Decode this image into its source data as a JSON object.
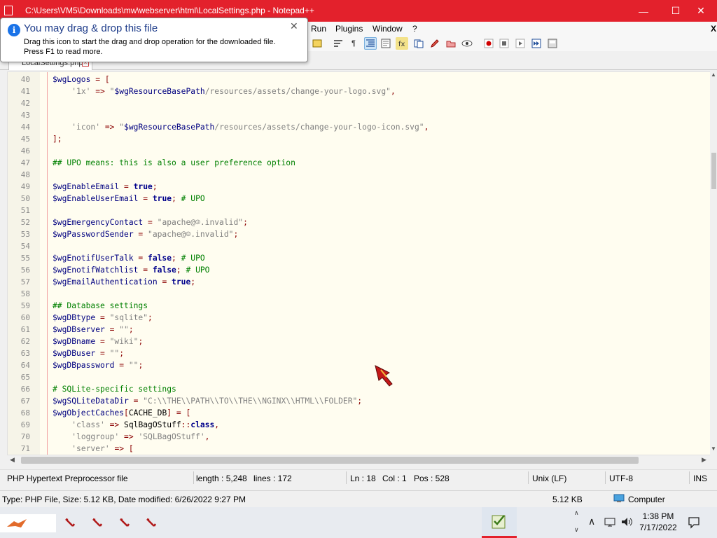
{
  "window": {
    "title": "C:\\Users\\VM5\\Downloads\\mw\\webserver\\html\\LocalSettings.php - Notepad++",
    "minimize_glyph": "—",
    "maximize_glyph": "☐",
    "close_glyph": "✕",
    "title_bar_color": "#e3212c"
  },
  "menu": {
    "items": [
      "Run",
      "Plugins",
      "Window",
      "?"
    ],
    "close_glyph": "X"
  },
  "tab": {
    "label": "LocalSettings.php"
  },
  "toast": {
    "title": "You may drag & drop this file",
    "body_line1": "Drag this icon to start the drag and drop operation for the downloaded file.",
    "body_line2": "Press F1 to read more.",
    "close_glyph": "✕",
    "icon": "info-icon"
  },
  "editor": {
    "lines": [
      {
        "n": "40",
        "tokens": [
          [
            "var",
            "$wgLogos"
          ],
          [
            "op",
            " = "
          ],
          [
            "op",
            "["
          ]
        ]
      },
      {
        "n": "41",
        "tokens": [
          [
            "plain",
            "    "
          ],
          [
            "str",
            "'1x'"
          ],
          [
            "op",
            " => "
          ],
          [
            "str",
            "\""
          ],
          [
            "var",
            "$wgResourceBasePath"
          ],
          [
            "str",
            "/resources/assets/change-your-logo.svg\""
          ],
          [
            "op",
            ","
          ]
        ]
      },
      {
        "n": "42",
        "tokens": []
      },
      {
        "n": "43",
        "tokens": []
      },
      {
        "n": "44",
        "tokens": [
          [
            "plain",
            "    "
          ],
          [
            "str",
            "'icon'"
          ],
          [
            "op",
            " => "
          ],
          [
            "str",
            "\""
          ],
          [
            "var",
            "$wgResourceBasePath"
          ],
          [
            "str",
            "/resources/assets/change-your-logo-icon.svg\""
          ],
          [
            "op",
            ","
          ]
        ]
      },
      {
        "n": "45",
        "tokens": [
          [
            "op",
            "];"
          ]
        ]
      },
      {
        "n": "46",
        "tokens": []
      },
      {
        "n": "47",
        "tokens": [
          [
            "cmt",
            "## UPO means: this is also a user preference option"
          ]
        ]
      },
      {
        "n": "48",
        "tokens": []
      },
      {
        "n": "49",
        "tokens": [
          [
            "var",
            "$wgEnableEmail"
          ],
          [
            "op",
            " = "
          ],
          [
            "kw",
            "true"
          ],
          [
            "op",
            ";"
          ]
        ]
      },
      {
        "n": "50",
        "tokens": [
          [
            "var",
            "$wgEnableUserEmail"
          ],
          [
            "op",
            " = "
          ],
          [
            "kw",
            "true"
          ],
          [
            "op",
            ";"
          ],
          [
            "cmt",
            " # UPO"
          ]
        ]
      },
      {
        "n": "51",
        "tokens": []
      },
      {
        "n": "52",
        "tokens": [
          [
            "var",
            "$wgEmergencyContact"
          ],
          [
            "op",
            " = "
          ],
          [
            "str",
            "\"apache@☺.invalid\""
          ],
          [
            "op",
            ";"
          ]
        ]
      },
      {
        "n": "53",
        "tokens": [
          [
            "var",
            "$wgPasswordSender"
          ],
          [
            "op",
            " = "
          ],
          [
            "str",
            "\"apache@☺.invalid\""
          ],
          [
            "op",
            ";"
          ]
        ]
      },
      {
        "n": "54",
        "tokens": []
      },
      {
        "n": "55",
        "tokens": [
          [
            "var",
            "$wgEnotifUserTalk"
          ],
          [
            "op",
            " = "
          ],
          [
            "kw",
            "false"
          ],
          [
            "op",
            ";"
          ],
          [
            "cmt",
            " # UPO"
          ]
        ]
      },
      {
        "n": "56",
        "tokens": [
          [
            "var",
            "$wgEnotifWatchlist"
          ],
          [
            "op",
            " = "
          ],
          [
            "kw",
            "false"
          ],
          [
            "op",
            ";"
          ],
          [
            "cmt",
            " # UPO"
          ]
        ]
      },
      {
        "n": "57",
        "tokens": [
          [
            "var",
            "$wgEmailAuthentication"
          ],
          [
            "op",
            " = "
          ],
          [
            "kw",
            "true"
          ],
          [
            "op",
            ";"
          ]
        ]
      },
      {
        "n": "58",
        "tokens": []
      },
      {
        "n": "59",
        "tokens": [
          [
            "cmt",
            "## Database settings"
          ]
        ]
      },
      {
        "n": "60",
        "tokens": [
          [
            "var",
            "$wgDBtype"
          ],
          [
            "op",
            " = "
          ],
          [
            "str",
            "\"sqlite\""
          ],
          [
            "op",
            ";"
          ]
        ]
      },
      {
        "n": "61",
        "tokens": [
          [
            "var",
            "$wgDBserver"
          ],
          [
            "op",
            " = "
          ],
          [
            "str",
            "\"\""
          ],
          [
            "op",
            ";"
          ]
        ]
      },
      {
        "n": "62",
        "tokens": [
          [
            "var",
            "$wgDBname"
          ],
          [
            "op",
            " = "
          ],
          [
            "str",
            "\"wiki\""
          ],
          [
            "op",
            ";"
          ]
        ]
      },
      {
        "n": "63",
        "tokens": [
          [
            "var",
            "$wgDBuser"
          ],
          [
            "op",
            " = "
          ],
          [
            "str",
            "\"\""
          ],
          [
            "op",
            ";"
          ]
        ]
      },
      {
        "n": "64",
        "tokens": [
          [
            "var",
            "$wgDBpassword"
          ],
          [
            "op",
            " = "
          ],
          [
            "str",
            "\"\""
          ],
          [
            "op",
            ";"
          ]
        ]
      },
      {
        "n": "65",
        "tokens": []
      },
      {
        "n": "66",
        "tokens": [
          [
            "cmt",
            "# SQLite-specific settings"
          ]
        ]
      },
      {
        "n": "67",
        "tokens": [
          [
            "var",
            "$wgSQLiteDataDir"
          ],
          [
            "op",
            " = "
          ],
          [
            "str",
            "\"C:\\\\THE\\\\PATH\\\\TO\\\\THE\\\\NGINX\\\\HTML\\\\FOLDER\""
          ],
          [
            "op",
            ";"
          ]
        ]
      },
      {
        "n": "68",
        "tokens": [
          [
            "var",
            "$wgObjectCaches"
          ],
          [
            "op",
            "["
          ],
          [
            "plain",
            "CACHE_DB"
          ],
          [
            "op",
            "] = ["
          ]
        ]
      },
      {
        "n": "69",
        "tokens": [
          [
            "plain",
            "    "
          ],
          [
            "str",
            "'class'"
          ],
          [
            "op",
            " => "
          ],
          [
            "plain",
            "SqlBagOStuff"
          ],
          [
            "op",
            "::"
          ],
          [
            "kw",
            "class"
          ],
          [
            "op",
            ","
          ]
        ]
      },
      {
        "n": "70",
        "tokens": [
          [
            "plain",
            "    "
          ],
          [
            "str",
            "'loggroup'"
          ],
          [
            "op",
            " => "
          ],
          [
            "str",
            "'SQLBagOStuff'"
          ],
          [
            "op",
            ","
          ]
        ]
      },
      {
        "n": "71",
        "tokens": [
          [
            "plain",
            "    "
          ],
          [
            "str",
            "'server'"
          ],
          [
            "op",
            " => ["
          ]
        ]
      }
    ]
  },
  "statusbar": {
    "filetype": "PHP Hypertext Preprocessor file",
    "length": "length : 5,248",
    "lines": "lines : 172",
    "ln": "Ln : 18",
    "col": "Col : 1",
    "pos": "Pos : 528",
    "eol": "Unix (LF)",
    "encoding": "UTF-8",
    "mode": "INS"
  },
  "explorer": {
    "details": "Type: PHP File, Size: 5.12 KB, Date modified: 6/26/2022 9:27 PM",
    "size": "5.12 KB",
    "location": "Computer"
  },
  "taskbar": {
    "time": "1:38 PM",
    "date": "7/17/2022"
  }
}
